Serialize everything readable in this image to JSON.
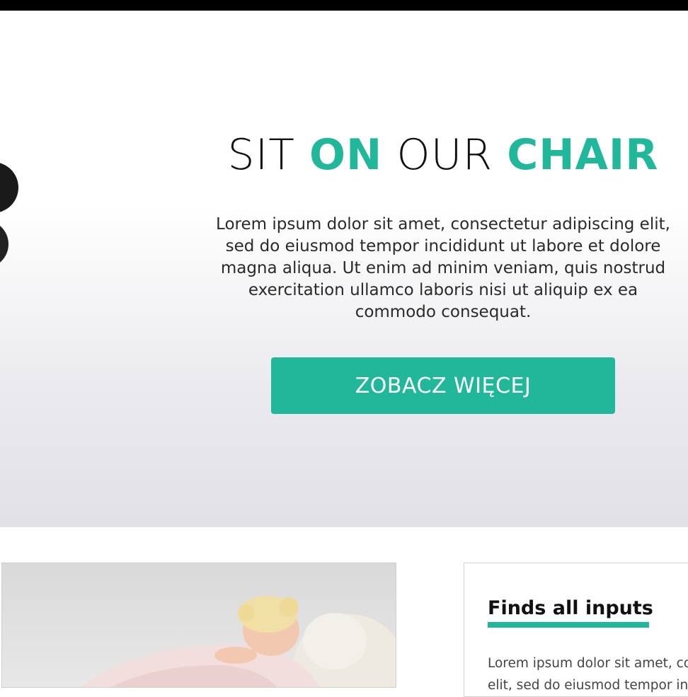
{
  "hero": {
    "title_parts": [
      "SIT ",
      "ON",
      " OUR ",
      "CHAIR"
    ],
    "description": "Lorem ipsum dolor sit amet, consectetur adipiscing elit, sed do eiusmod tempor incididunt ut labore et dolore magna aliqua. Ut enim ad minim veniam, quis nostrud exercitation ullamco laboris nisi ut aliquip ex ea commodo consequat.",
    "cta_label": "ZOBACZ WIĘCEJ"
  },
  "feature": {
    "title": "Finds all inputs",
    "text_lines": [
      "Lorem ipsum dolor sit amet, cor",
      "elit, sed do eiusmod tempor inc"
    ]
  },
  "colors": {
    "accent": "#21b79a",
    "dark_text": "#111111"
  },
  "icons": {
    "hero_image": "black-ball-chair-image",
    "feature_image": "child-sleeping-on-chair-photo"
  }
}
